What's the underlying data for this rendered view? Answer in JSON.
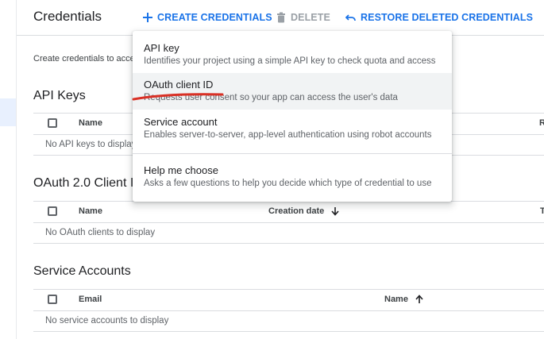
{
  "header": {
    "title": "Credentials",
    "create_label": "CREATE CREDENTIALS",
    "delete_label": "DELETE",
    "restore_label": "RESTORE DELETED CREDENTIALS"
  },
  "intro_text": "Create credentials to access your enabled APIs.",
  "sections": {
    "api_keys": {
      "title": "API Keys",
      "col_name": "Name",
      "col_right": "R",
      "empty": "No API keys to display"
    },
    "oauth": {
      "title": "OAuth 2.0 Client IDs",
      "col_name": "Name",
      "col_date": "Creation date",
      "col_right": "T",
      "empty": "No OAuth clients to display"
    },
    "service_accounts": {
      "title": "Service Accounts",
      "col_email": "Email",
      "col_name": "Name",
      "empty": "No service accounts to display"
    }
  },
  "menu": {
    "items": [
      {
        "title": "API key",
        "desc": "Identifies your project using a simple API key to check quota and access"
      },
      {
        "title": "OAuth client ID",
        "desc": "Requests user consent so your app can access the user's data"
      },
      {
        "title": "Service account",
        "desc": "Enables server-to-server, app-level authentication using robot accounts"
      },
      {
        "title": "Help me choose",
        "desc": "Asks a few questions to help you decide which type of credential to use"
      }
    ]
  },
  "colors": {
    "accent": "#1a73e8",
    "annotation": "#d93025"
  },
  "icons": {
    "create": "plus-icon",
    "delete": "trash-icon",
    "restore": "undo-icon",
    "sort_down": "arrow-down-icon",
    "sort_up": "arrow-up-icon"
  }
}
